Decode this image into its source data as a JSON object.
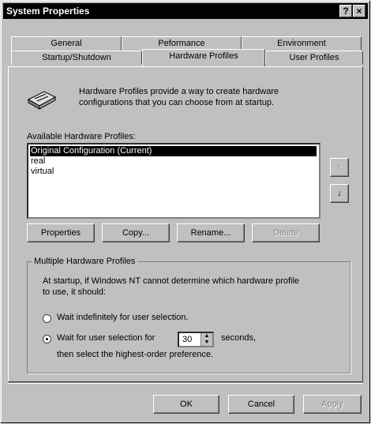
{
  "window": {
    "title": "System Properties",
    "help_glyph": "?",
    "close_glyph": "×"
  },
  "tabs_row1": [
    "General",
    "Peformance",
    "Environment"
  ],
  "tabs_row2": [
    "Startup/Shutdown",
    "Hardware Profiles",
    "User Profiles"
  ],
  "selected_tab": "Hardware Profiles",
  "intro_text_1": "Hardware Profiles provide a way to create hardware",
  "intro_text_2": "configurations that you can choose from at startup.",
  "profiles_label": "Available Hardware Profiles:",
  "profiles": [
    "Original Configuration (Current)",
    "real",
    "virtual"
  ],
  "selected_profile": "Original Configuration (Current)",
  "move_up_glyph": "↑",
  "move_down_glyph": "↓",
  "buttons": {
    "properties": "Properties",
    "copy": "Copy...",
    "rename": "Rename...",
    "delete": "Delete"
  },
  "group": {
    "title": "Multiple Hardware Profiles",
    "desc_1": "At startup, if Windows NT cannot determine which hardware profile",
    "desc_2": "to use, it should:",
    "option_wait_indef": "Wait indefinitely for user selection.",
    "option_wait_for": "Wait for user selection for",
    "seconds_value": "30",
    "seconds_label": "seconds,",
    "then_text": "then select the highest-order preference.",
    "selected_option": "wait_for"
  },
  "footer": {
    "ok": "OK",
    "cancel": "Cancel",
    "apply": "Apply"
  }
}
